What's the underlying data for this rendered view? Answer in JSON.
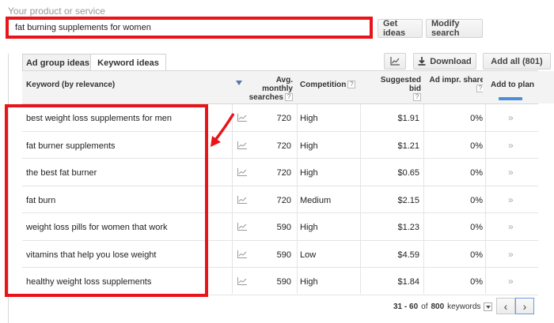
{
  "search": {
    "label": "Your product or service",
    "value": "fat burning supplements for women",
    "get_ideas": "Get ideas",
    "modify_search": "Modify search"
  },
  "tabs": {
    "ad_group": "Ad group ideas",
    "keyword": "Keyword ideas"
  },
  "toolbar": {
    "chart_icon": "line-chart-icon",
    "download_label": "Download",
    "add_all_label": "Add all (801)"
  },
  "columns": {
    "keyword": "Keyword (by relevance)",
    "searches_1": "Avg. monthly",
    "searches_2": "searches",
    "competition": "Competition",
    "bid": "Suggested bid",
    "share_1": "Ad impr. share",
    "add_to_plan": "Add to plan",
    "help": "?"
  },
  "rows": [
    {
      "keyword": "best weight loss supplements for men",
      "searches": "720",
      "competition": "High",
      "bid": "$1.91",
      "share": "0%",
      "add": "»"
    },
    {
      "keyword": "fat burner supplements",
      "searches": "720",
      "competition": "High",
      "bid": "$1.21",
      "share": "0%",
      "add": "»"
    },
    {
      "keyword": "the best fat burner",
      "searches": "720",
      "competition": "High",
      "bid": "$0.65",
      "share": "0%",
      "add": "»"
    },
    {
      "keyword": "fat burn",
      "searches": "720",
      "competition": "Medium",
      "bid": "$2.15",
      "share": "0%",
      "add": "»"
    },
    {
      "keyword": "weight loss pills for women that work",
      "searches": "590",
      "competition": "High",
      "bid": "$1.23",
      "share": "0%",
      "add": "»"
    },
    {
      "keyword": "vitamins that help you lose weight",
      "searches": "590",
      "competition": "Low",
      "bid": "$4.59",
      "share": "0%",
      "add": "»"
    },
    {
      "keyword": "healthy weight loss supplements",
      "searches": "590",
      "competition": "High",
      "bid": "$1.84",
      "share": "0%",
      "add": "»"
    }
  ],
  "pagination": {
    "range": "31 - 60",
    "of": "of",
    "total": "800",
    "unit": "keywords",
    "prev": "‹",
    "next": "›"
  },
  "colors": {
    "highlight": "#e8141a",
    "accent": "#4a90d9"
  }
}
